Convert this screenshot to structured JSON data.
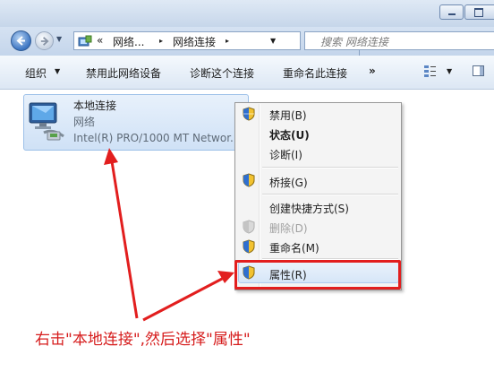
{
  "address_bar": {
    "overflow": "«",
    "crumb_1": "网络...",
    "crumb_2": "网络连接",
    "separator": "▸",
    "search_placeholder": "搜索 网络连接"
  },
  "toolbar": {
    "organize": "组织",
    "disable_device": "禁用此网络设备",
    "diagnose": "诊断这个连接",
    "rename": "重命名此连接",
    "more": "»"
  },
  "connection": {
    "name": "本地连接",
    "network": "网络",
    "adapter": "Intel(R) PRO/1000 MT Networ..."
  },
  "context_menu": {
    "disable": "禁用(B)",
    "status": "状态(U)",
    "diagnose": "诊断(I)",
    "bridge": "桥接(G)",
    "create_shortcut": "创建快捷方式(S)",
    "delete": "删除(D)",
    "rename": "重命名(M)",
    "properties": "属性(R)"
  },
  "annotation": {
    "text": "右击\"本地连接\",然后选择\"属性\""
  },
  "colors": {
    "annotation_red": "#e21e1e",
    "selection_blue": "#d6e6f8"
  }
}
